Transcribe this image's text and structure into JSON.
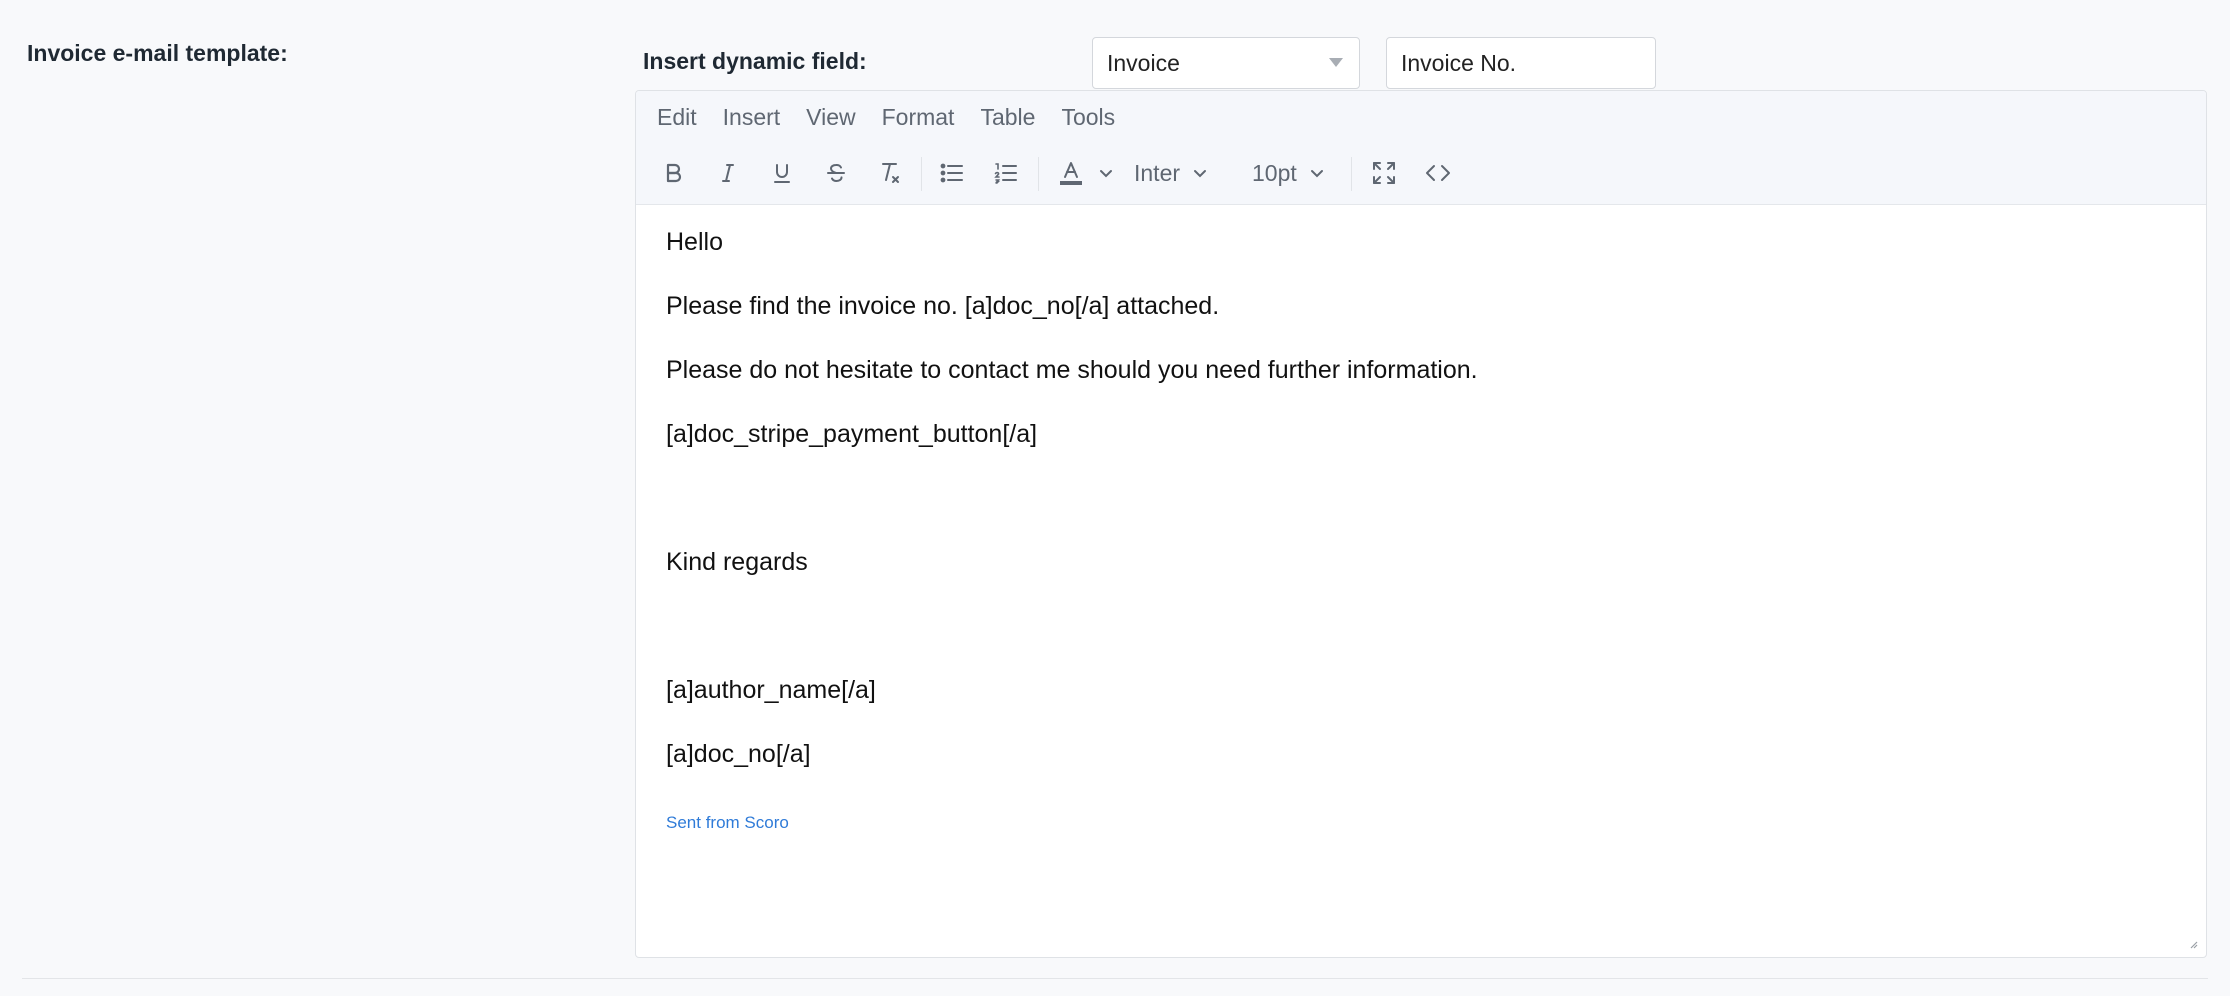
{
  "form": {
    "template_label": "Invoice e-mail template:",
    "dynamic_field_label": "Insert dynamic field:",
    "category_select_value": "Invoice",
    "field_select_value": "Invoice No."
  },
  "editor": {
    "menu": [
      "Edit",
      "Insert",
      "View",
      "Format",
      "Table",
      "Tools"
    ],
    "toolbar": {
      "font_family": "Inter",
      "font_size": "10pt"
    },
    "body": {
      "greeting": "Hello",
      "line_attached": "Please find the invoice no. [a]doc_no[/a] attached.",
      "line_contact": "Please do not hesitate to contact me should you need further information.",
      "line_payment": "[a]doc_stripe_payment_button[/a]",
      "closing": "Kind regards",
      "author": "[a]author_name[/a]",
      "doc_no": "[a]doc_no[/a]",
      "footer_link": "Sent from Scoro"
    }
  },
  "colors": {
    "link": "#2f7bd8",
    "toolbar_icon": "#5f6772",
    "editor_header_bg": "#f5f7fb"
  }
}
